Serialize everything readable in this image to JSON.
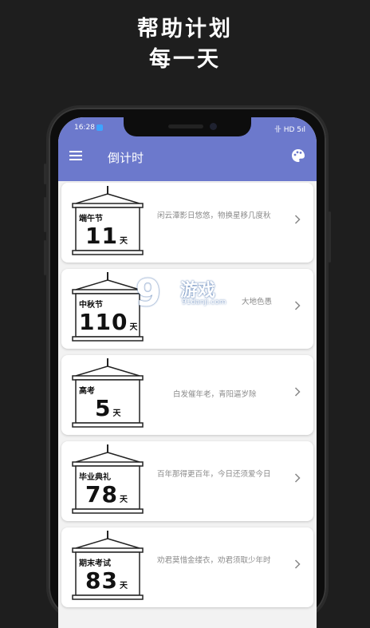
{
  "promo": {
    "line1": "帮助计划",
    "line2": "每一天"
  },
  "status_bar": {
    "time": "16:28",
    "right": "卝 HD 5ıl"
  },
  "app_bar": {
    "title": "倒计时",
    "menu_icon": "hamburger-menu-icon",
    "theme_icon": "palette-icon",
    "color": "#6c79cc"
  },
  "items": [
    {
      "name": "端午节",
      "days": "11",
      "unit": "天",
      "quote": "闲云潭影日悠悠，物换星移几度秋"
    },
    {
      "name": "中秋节",
      "days": "110",
      "unit": "天",
      "quote": "大地色愚"
    },
    {
      "name": "高考",
      "days": "5",
      "unit": "天",
      "quote": "白发催年老，青阳逼岁除"
    },
    {
      "name": "毕业典礼",
      "days": "78",
      "unit": "天",
      "quote": "百年那得更百年，今日还须爱今日"
    },
    {
      "name": "期末考试",
      "days": "83",
      "unit": "天",
      "quote": "劝君莫惜金缕衣，劝君须取少年时"
    }
  ],
  "watermark": {
    "logo": "9",
    "brand": "游戏",
    "domain": "91danji.com"
  }
}
